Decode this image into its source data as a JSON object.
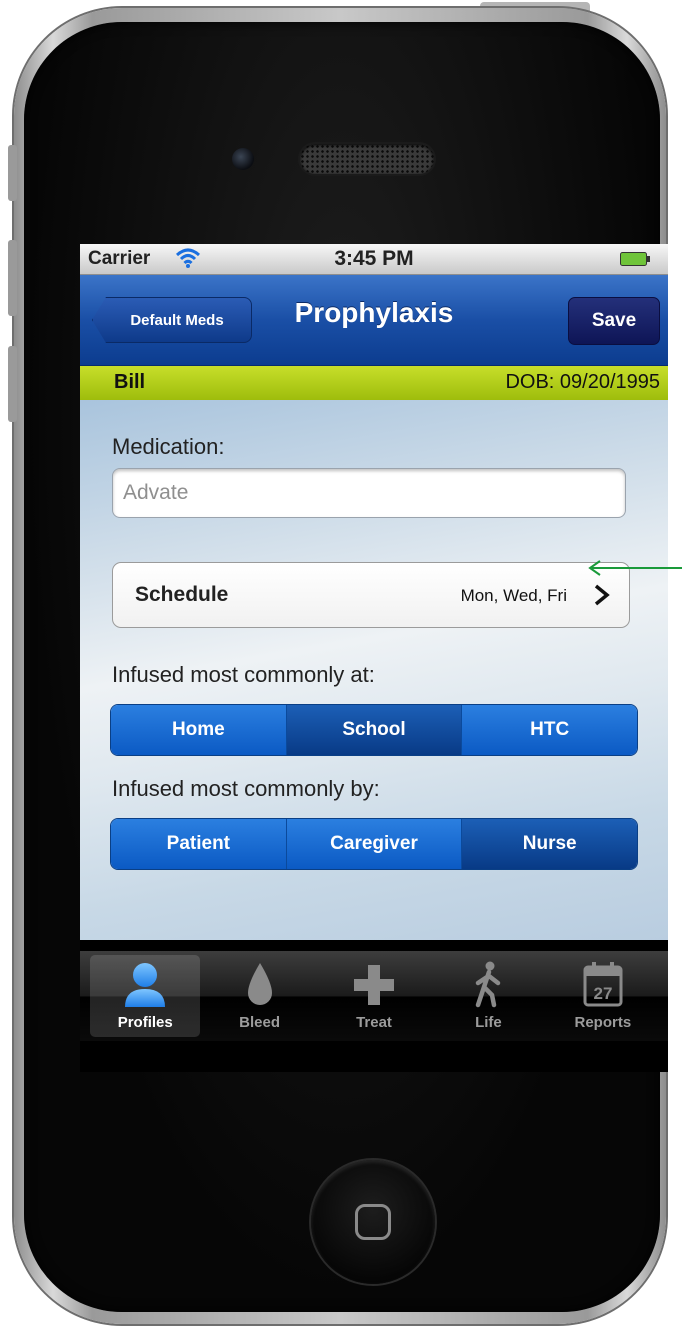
{
  "status_bar": {
    "carrier": "Carrier",
    "time": "3:45 PM",
    "wifi_icon": "wifi-icon",
    "battery_icon": "battery-icon"
  },
  "nav": {
    "back_label": "Default Meds",
    "title": "Prophylaxis",
    "save_label": "Save"
  },
  "patient": {
    "name": "Bill",
    "dob": "DOB: 09/20/1995"
  },
  "form": {
    "medication_label": "Medication:",
    "medication_placeholder": "Advate",
    "medication_value": "",
    "schedule_label": "Schedule",
    "schedule_value": "Mon, Wed, Fri",
    "infused_at_label": "Infused most commonly at:",
    "infused_at_options": [
      "Home",
      "School",
      "HTC"
    ],
    "infused_at_selected": "School",
    "infused_by_label": "Infused most commonly by:",
    "infused_by_options": [
      "Patient",
      "Caregiver",
      "Nurse"
    ],
    "infused_by_selected": "Nurse"
  },
  "tab_bar": {
    "items": [
      {
        "label": "Profiles",
        "icon": "person-icon",
        "active": true
      },
      {
        "label": "Bleed",
        "icon": "drop-icon",
        "active": false
      },
      {
        "label": "Treat",
        "icon": "cross-icon",
        "active": false
      },
      {
        "label": "Life",
        "icon": "walking-person-icon",
        "active": false
      },
      {
        "label": "Reports",
        "icon": "calendar-icon",
        "active": false
      }
    ],
    "calendar_day": "27"
  },
  "colors": {
    "nav_blue": "#1a4fa6",
    "patient_bar_green": "#b5d11a",
    "segment_blue": "#0b5ac4",
    "annotation_green": "#1a9a3a"
  }
}
